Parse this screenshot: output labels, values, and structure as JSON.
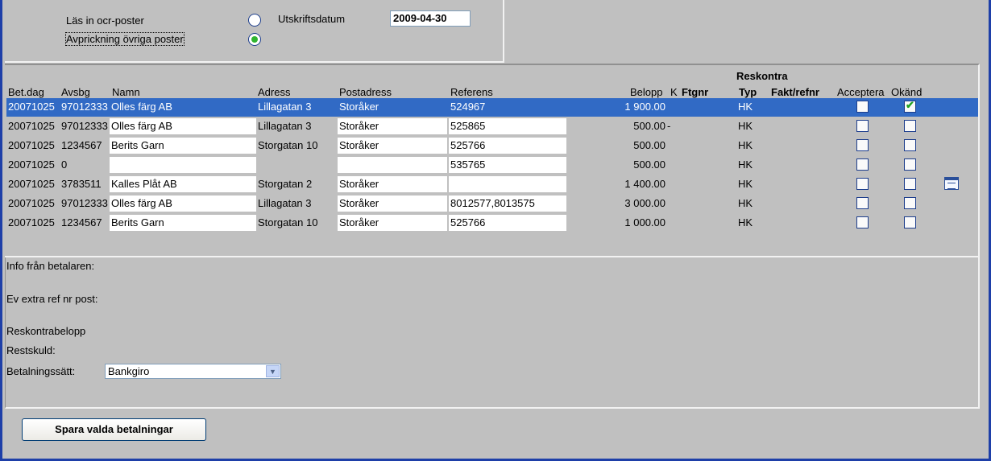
{
  "top": {
    "option_read_ocr": "Läs in ocr-poster",
    "option_other": "Avprickning övriga poster",
    "print_date_label": "Utskriftsdatum",
    "print_date_value": "2009-04-30"
  },
  "table": {
    "group_header": "Reskontra",
    "headers": {
      "betdag": "Bet.dag",
      "avsbg": "Avsbg",
      "namn": "Namn",
      "adress": "Adress",
      "postadress": "Postadress",
      "referens": "Referens",
      "belopp": "Belopp",
      "k": "K",
      "ftgnr": "Ftgnr",
      "typ": "Typ",
      "fakt": "Fakt/refnr",
      "acceptera": "Acceptera",
      "okand": "Okänd"
    },
    "rows": [
      {
        "betdag": "20071025",
        "avsbg": "97012333",
        "namn": "Olles färg AB",
        "adress": "Lillagatan 3",
        "postadress": "Storåker",
        "referens": "524967",
        "belopp": "1 900.00",
        "k": "",
        "typ": "HK",
        "acceptera": false,
        "okand": true
      },
      {
        "betdag": "20071025",
        "avsbg": "97012333",
        "namn": "Olles färg AB",
        "adress": "Lillagatan 3",
        "postadress": "Storåker",
        "referens": "525865",
        "belopp": "500.00",
        "k": "-",
        "typ": "HK",
        "acceptera": false,
        "okand": false
      },
      {
        "betdag": "20071025",
        "avsbg": "1234567",
        "namn": "Berits Garn",
        "adress": "Storgatan 10",
        "postadress": "Storåker",
        "referens": "525766",
        "belopp": "500.00",
        "k": "",
        "typ": "HK",
        "acceptera": false,
        "okand": false
      },
      {
        "betdag": "20071025",
        "avsbg": "0",
        "namn": "",
        "adress": "",
        "postadress": "",
        "referens": "535765",
        "belopp": "500.00",
        "k": "",
        "typ": "HK",
        "acceptera": false,
        "okand": false
      },
      {
        "betdag": "20071025",
        "avsbg": "3783511",
        "namn": "Kalles Plåt AB",
        "adress": "Storgatan 2",
        "postadress": "Storåker",
        "referens": "",
        "belopp": "1 400.00",
        "k": "",
        "typ": "HK",
        "acceptera": false,
        "okand": false
      },
      {
        "betdag": "20071025",
        "avsbg": "97012333",
        "namn": "Olles färg AB",
        "adress": "Lillagatan 3",
        "postadress": "Storåker",
        "referens": "8012577,8013575",
        "belopp": "3 000.00",
        "k": "",
        "typ": "HK",
        "acceptera": false,
        "okand": false
      },
      {
        "betdag": "20071025",
        "avsbg": "1234567",
        "namn": "Berits Garn",
        "adress": "Storgatan 10",
        "postadress": "Storåker",
        "referens": "525766",
        "belopp": "1 000.00",
        "k": "",
        "typ": "HK",
        "acceptera": false,
        "okand": false
      }
    ]
  },
  "details": {
    "info_label": "Info från betalaren:",
    "extra_ref_label": "Ev extra ref nr post:",
    "reskontra_label": "Reskontrabelopp",
    "restskuld_label": "Restskuld:",
    "payment_method_label": "Betalningssätt:",
    "payment_method_value": "Bankgiro"
  },
  "actions": {
    "save_label": "Spara valda betalningar"
  }
}
